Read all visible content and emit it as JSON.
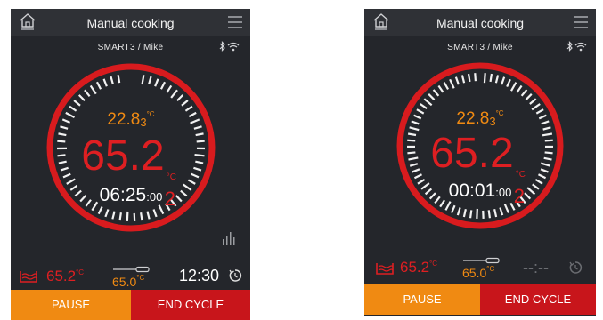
{
  "colors": {
    "accent_orange": "#f08a12",
    "accent_red": "#de1f22",
    "screen_bg": "#24262b"
  },
  "screens": [
    {
      "header": {
        "title": "Manual cooking",
        "home_icon": "home-menu-icon",
        "menu_icon": "hamburger-menu-icon"
      },
      "user_line": "SMART3 / Mike",
      "status_icons": [
        "bluetooth-icon",
        "wifi-icon"
      ],
      "dial": {
        "ambient_main": "22.8",
        "ambient_dec": "3",
        "ambient_unit": "°C",
        "core_main": "65.2",
        "core_dec": "2",
        "core_unit": "°C",
        "timer_main": "06:25",
        "timer_sec": ":00"
      },
      "graph_icon": "bar-graph-icon",
      "footer": {
        "bath_value": "65.2",
        "bath_unit": "°C",
        "probe_value": "65.0",
        "probe_unit": "°C",
        "clock_value": "12:30",
        "reset_icon": "timer-reset-icon"
      },
      "buttons": {
        "pause": "PAUSE",
        "end": "END CYCLE"
      }
    },
    {
      "header": {
        "title": "Manual cooking",
        "home_icon": "home-menu-icon",
        "menu_icon": "hamburger-menu-icon"
      },
      "user_line": "SMART3 / Mike",
      "status_icons": [
        "bluetooth-icon",
        "wifi-icon"
      ],
      "dial": {
        "ambient_main": "22.8",
        "ambient_dec": "3",
        "ambient_unit": "°C",
        "core_main": "65.2",
        "core_dec": "2",
        "core_unit": "°C",
        "timer_main": "00:01",
        "timer_sec": ":00"
      },
      "footer": {
        "bath_value": "65.2",
        "bath_unit": "°C",
        "probe_value": "65.0",
        "probe_unit": "°C",
        "clock_value": "--:--",
        "reset_icon": "timer-reset-icon"
      },
      "buttons": {
        "pause": "PAUSE",
        "end": "END CYCLE"
      }
    }
  ]
}
